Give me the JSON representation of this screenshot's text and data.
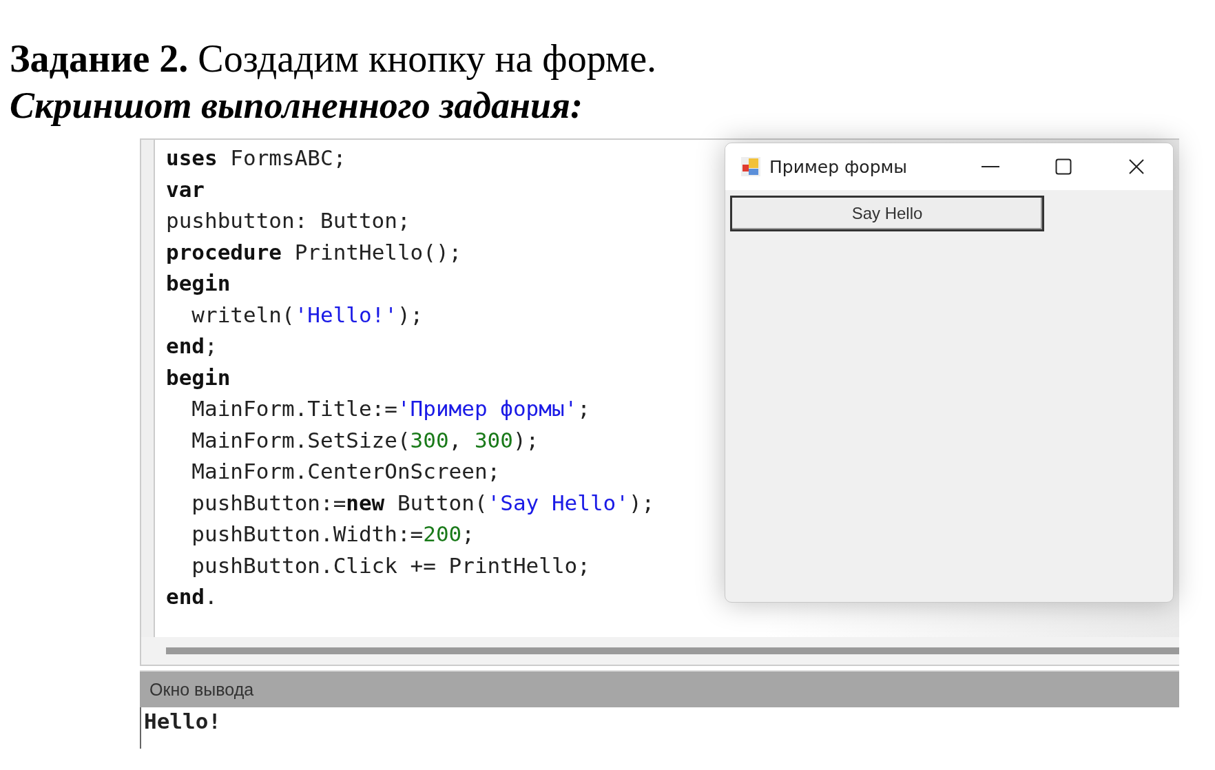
{
  "heading": {
    "task_label": "Задание 2.",
    "task_text": "Создадим кнопку на форме.",
    "subtitle": "Скриншот выполненного задания:"
  },
  "editor": {
    "lines": [
      [
        {
          "kind": "kw",
          "text": "uses"
        },
        {
          "kind": "plain",
          "text": " FormsABC;"
        }
      ],
      [
        {
          "kind": "kw",
          "text": "var"
        }
      ],
      [
        {
          "kind": "plain",
          "text": "pushbutton: Button;"
        }
      ],
      [
        {
          "kind": "kw",
          "text": "procedure"
        },
        {
          "kind": "plain",
          "text": " PrintHello();"
        }
      ],
      [
        {
          "kind": "kw",
          "text": "begin"
        }
      ],
      [
        {
          "kind": "plain",
          "text": "  writeln("
        },
        {
          "kind": "str",
          "text": "'Hello!'"
        },
        {
          "kind": "plain",
          "text": ");"
        }
      ],
      [
        {
          "kind": "kw",
          "text": "end"
        },
        {
          "kind": "plain",
          "text": ";"
        }
      ],
      [
        {
          "kind": "kw",
          "text": "begin"
        }
      ],
      [
        {
          "kind": "plain",
          "text": "  MainForm.Title:="
        },
        {
          "kind": "str",
          "text": "'Пример формы'"
        },
        {
          "kind": "plain",
          "text": ";"
        }
      ],
      [
        {
          "kind": "plain",
          "text": "  MainForm.SetSize("
        },
        {
          "kind": "num",
          "text": "300"
        },
        {
          "kind": "plain",
          "text": ", "
        },
        {
          "kind": "num",
          "text": "300"
        },
        {
          "kind": "plain",
          "text": ");"
        }
      ],
      [
        {
          "kind": "plain",
          "text": "  MainForm.CenterOnScreen;"
        }
      ],
      [
        {
          "kind": "plain",
          "text": "  pushButton:="
        },
        {
          "kind": "kw",
          "text": "new"
        },
        {
          "kind": "plain",
          "text": " Button("
        },
        {
          "kind": "str",
          "text": "'Say Hello'"
        },
        {
          "kind": "plain",
          "text": ");"
        }
      ],
      [
        {
          "kind": "plain",
          "text": "  pushButton.Width:="
        },
        {
          "kind": "num",
          "text": "200"
        },
        {
          "kind": "plain",
          "text": ";"
        }
      ],
      [
        {
          "kind": "plain",
          "text": "  pushButton.Click += PrintHello;"
        }
      ],
      [
        {
          "kind": "kw",
          "text": "end"
        },
        {
          "kind": "plain",
          "text": "."
        }
      ]
    ]
  },
  "form_window": {
    "title": "Пример формы",
    "button": "Say Hello"
  },
  "output": {
    "title": "Окно вывода",
    "text": "Hello!"
  }
}
